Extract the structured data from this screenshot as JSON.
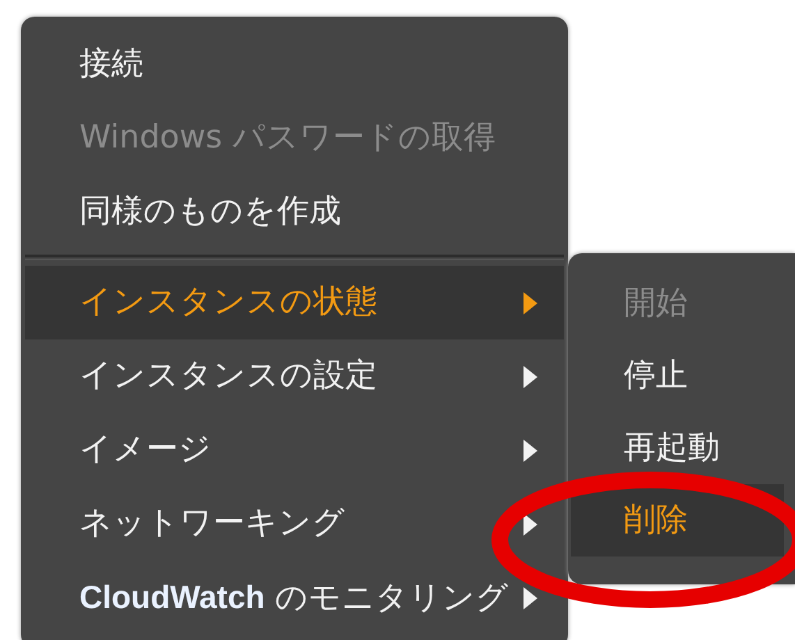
{
  "menu": {
    "items": [
      {
        "kind": "item",
        "label": "接続",
        "disabled": false,
        "selected": false,
        "submenu": false
      },
      {
        "kind": "item",
        "label": "Windows パスワードの取得",
        "disabled": true,
        "selected": false,
        "submenu": false
      },
      {
        "kind": "item",
        "label": "同様のものを作成",
        "disabled": false,
        "selected": false,
        "submenu": false
      },
      {
        "kind": "separator"
      },
      {
        "kind": "item",
        "label": "インスタンスの状態",
        "disabled": false,
        "selected": true,
        "submenu": true
      },
      {
        "kind": "item",
        "label": "インスタンスの設定",
        "disabled": false,
        "selected": false,
        "submenu": true
      },
      {
        "kind": "item",
        "label": "イメージ",
        "disabled": false,
        "selected": false,
        "submenu": true
      },
      {
        "kind": "item",
        "label": "ネットワーキング",
        "disabled": false,
        "selected": false,
        "submenu": true
      },
      {
        "kind": "item",
        "label": "**CloudWatch** のモニタリング",
        "disabled": false,
        "selected": false,
        "submenu": true
      }
    ]
  },
  "submenu": {
    "items": [
      {
        "label": "開始",
        "disabled": true,
        "selected": false
      },
      {
        "label": "停止",
        "disabled": false,
        "selected": false
      },
      {
        "label": "再起動",
        "disabled": false,
        "selected": false
      },
      {
        "label": "削除",
        "disabled": false,
        "selected": true
      }
    ]
  },
  "annotation": {
    "kind": "ellipse"
  }
}
